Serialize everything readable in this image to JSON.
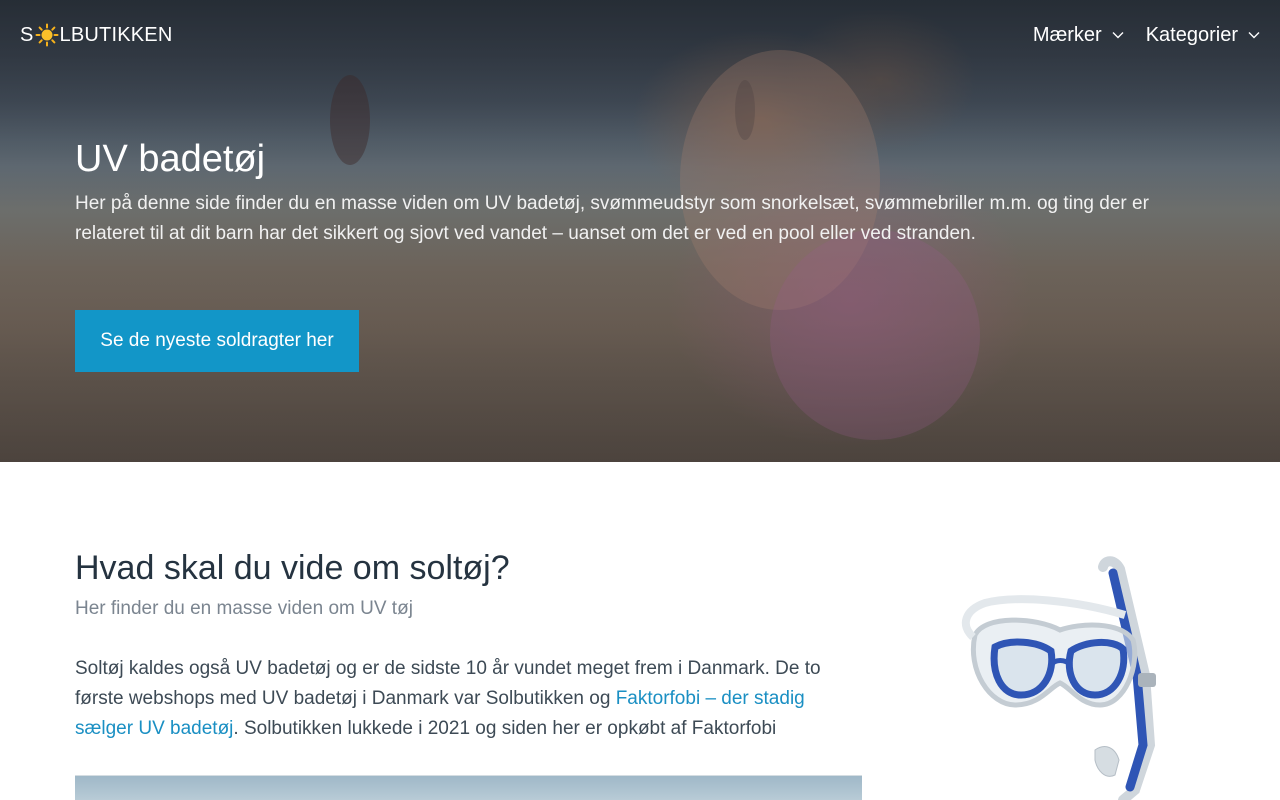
{
  "brand": {
    "logo_prefix": "S",
    "logo_suffix": "LBUTIKKEN",
    "sun_icon": "sun-icon"
  },
  "nav": {
    "items": [
      {
        "label": "Mærker",
        "icon": "chevron-down-icon"
      },
      {
        "label": "Kategorier",
        "icon": "chevron-down-icon"
      }
    ]
  },
  "hero": {
    "title": "UV badetøj",
    "text": "Her på denne side finder du en masse viden om UV badetøj, svømmeudstyr som snorkelsæt, svømmebriller m.m. og ting der er relateret til at dit barn har det sikkert og sjovt ved vandet – uanset om det er ved en pool eller ved stranden.",
    "cta_label": "Se de nyeste soldragter her"
  },
  "section": {
    "title": "Hvad skal du vide om soltøj?",
    "subtitle": "Her finder du en masse viden om UV tøj",
    "paragraph_start": "Soltøj kaldes også UV badetøj og er de sidste 10 år vundet meget frem i Danmark. De to første webshops med UV badetøj i Danmark var Solbutikken og ",
    "paragraph_link": "Faktorfobi – der stadig sælger UV badetøj",
    "paragraph_end": ". Solbutikken lukkede i 2021 og siden her er opkøbt af Faktorfobi"
  },
  "colors": {
    "accent": "#1296c8",
    "link": "#1a8fc3",
    "heading": "#253340",
    "muted": "#7b8590",
    "body": "#3d4a55"
  }
}
